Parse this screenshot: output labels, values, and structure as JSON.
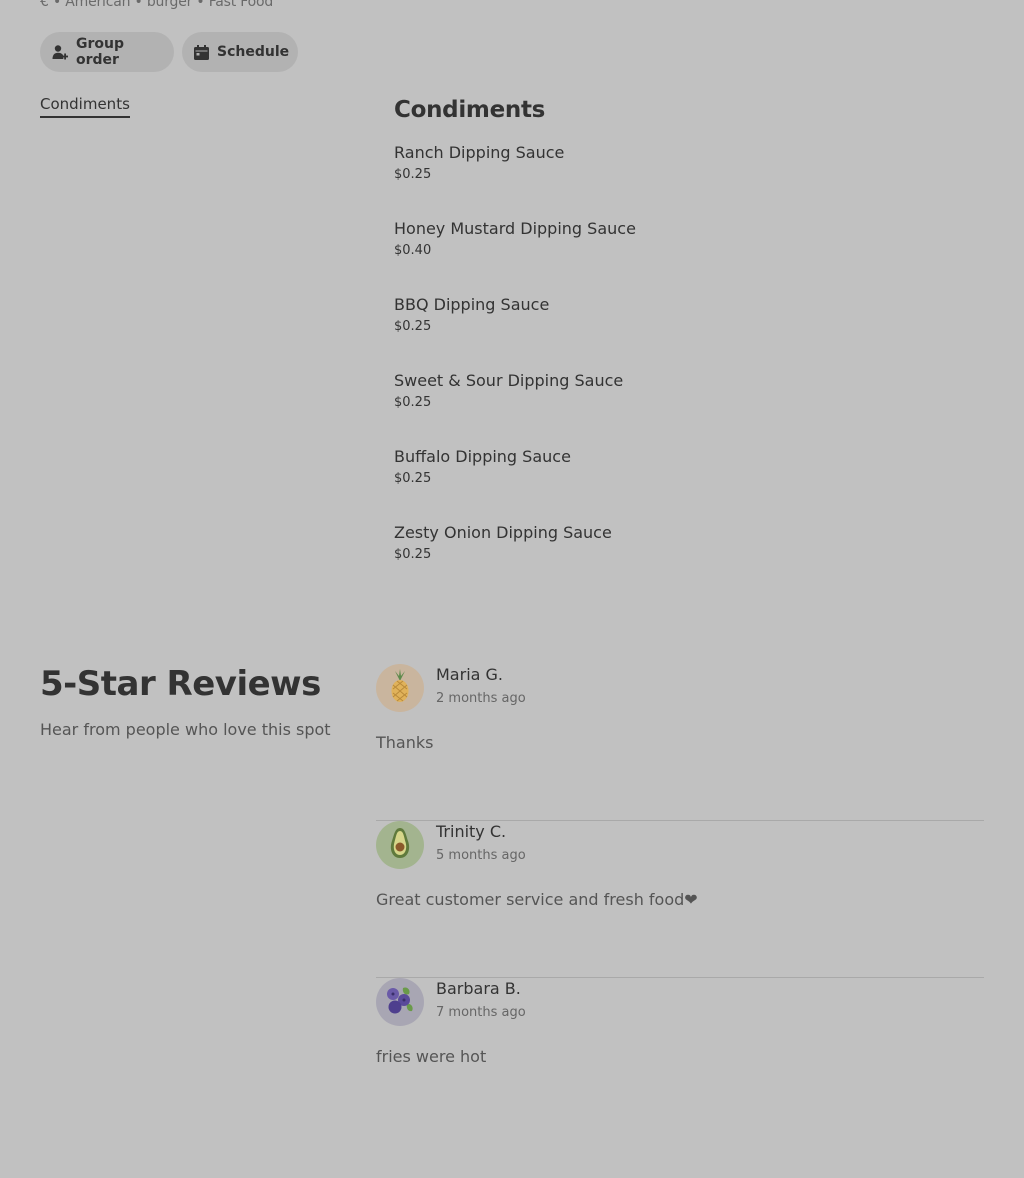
{
  "store": {
    "tags_line": "€ • American • burger • Fast Food"
  },
  "actions": {
    "group_order_label": "Group order",
    "schedule_label": "Schedule"
  },
  "categories": {
    "active": "Condiments"
  },
  "menu": {
    "section_title": "Condiments",
    "items": [
      {
        "name": "Ranch Dipping Sauce",
        "price": "$0.25"
      },
      {
        "name": "Honey Mustard Dipping Sauce",
        "price": "$0.40"
      },
      {
        "name": "BBQ Dipping Sauce",
        "price": "$0.25"
      },
      {
        "name": "Sweet & Sour Dipping Sauce",
        "price": "$0.25"
      },
      {
        "name": "Buffalo Dipping Sauce",
        "price": "$0.25"
      },
      {
        "name": "Zesty Onion Dipping Sauce",
        "price": "$0.25"
      }
    ]
  },
  "reviews": {
    "title": "5-Star Reviews",
    "subtitle": "Hear from people who love this spot",
    "items": [
      {
        "name": "Maria G.",
        "time": "2 months ago",
        "text": "Thanks",
        "avatar_icon": "pineapple-icon",
        "avatar_color": "#c9b59e"
      },
      {
        "name": "Trinity C.",
        "time": "5 months ago",
        "text": "Great customer service and fresh food❤",
        "avatar_icon": "avocado-icon",
        "avatar_color": "#a3b48f"
      },
      {
        "name": "Barbara B.",
        "time": "7 months ago",
        "text": "fries were hot",
        "avatar_icon": "blueberry-icon",
        "avatar_color": "#a8a6b3"
      }
    ]
  }
}
